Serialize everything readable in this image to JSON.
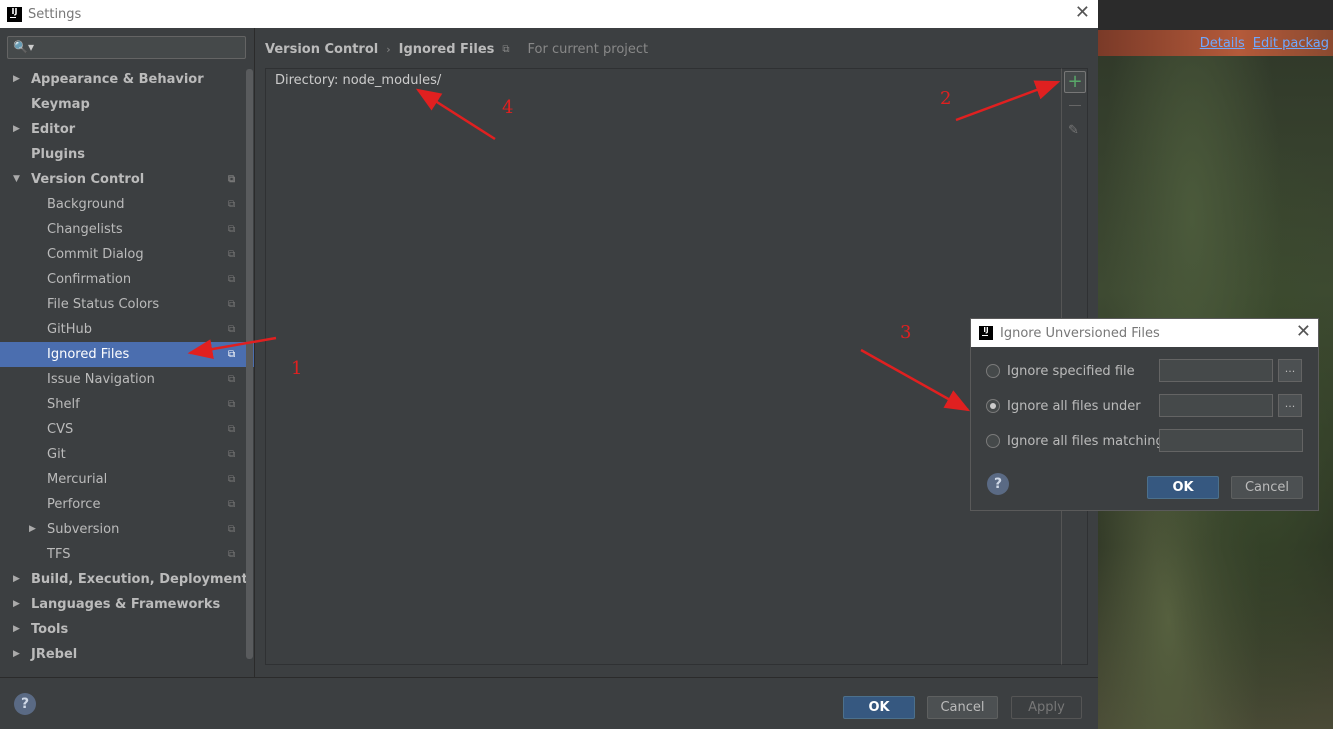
{
  "window": {
    "title": "Settings"
  },
  "background": {
    "links": [
      "Details",
      "Edit packag"
    ]
  },
  "search": {
    "placeholder": "",
    "icon": "search-icon"
  },
  "sidebar": {
    "items": [
      {
        "label": "Appearance & Behavior",
        "level": 0,
        "bold": true,
        "arrow": "collapsed",
        "copy": false
      },
      {
        "label": "Keymap",
        "level": 0,
        "bold": true,
        "arrow": "none",
        "copy": false
      },
      {
        "label": "Editor",
        "level": 0,
        "bold": true,
        "arrow": "collapsed",
        "copy": false
      },
      {
        "label": "Plugins",
        "level": 0,
        "bold": true,
        "arrow": "none",
        "copy": false
      },
      {
        "label": "Version Control",
        "level": 0,
        "bold": true,
        "arrow": "expanded",
        "copy": true
      },
      {
        "label": "Background",
        "level": 1,
        "bold": false,
        "arrow": "none",
        "copy": true
      },
      {
        "label": "Changelists",
        "level": 1,
        "bold": false,
        "arrow": "none",
        "copy": true
      },
      {
        "label": "Commit Dialog",
        "level": 1,
        "bold": false,
        "arrow": "none",
        "copy": true
      },
      {
        "label": "Confirmation",
        "level": 1,
        "bold": false,
        "arrow": "none",
        "copy": true
      },
      {
        "label": "File Status Colors",
        "level": 1,
        "bold": false,
        "arrow": "none",
        "copy": true
      },
      {
        "label": "GitHub",
        "level": 1,
        "bold": false,
        "arrow": "none",
        "copy": true
      },
      {
        "label": "Ignored Files",
        "level": 1,
        "bold": false,
        "arrow": "none",
        "copy": true,
        "selected": true
      },
      {
        "label": "Issue Navigation",
        "level": 1,
        "bold": false,
        "arrow": "none",
        "copy": true
      },
      {
        "label": "Shelf",
        "level": 1,
        "bold": false,
        "arrow": "none",
        "copy": true
      },
      {
        "label": "CVS",
        "level": 1,
        "bold": false,
        "arrow": "none",
        "copy": true
      },
      {
        "label": "Git",
        "level": 1,
        "bold": false,
        "arrow": "none",
        "copy": true
      },
      {
        "label": "Mercurial",
        "level": 1,
        "bold": false,
        "arrow": "none",
        "copy": true
      },
      {
        "label": "Perforce",
        "level": 1,
        "bold": false,
        "arrow": "none",
        "copy": true
      },
      {
        "label": "Subversion",
        "level": 1,
        "bold": false,
        "arrow": "collapsed",
        "copy": true
      },
      {
        "label": "TFS",
        "level": 1,
        "bold": false,
        "arrow": "none",
        "copy": true
      },
      {
        "label": "Build, Execution, Deployment",
        "level": 0,
        "bold": true,
        "arrow": "collapsed",
        "copy": false
      },
      {
        "label": "Languages & Frameworks",
        "level": 0,
        "bold": true,
        "arrow": "collapsed",
        "copy": false
      },
      {
        "label": "Tools",
        "level": 0,
        "bold": true,
        "arrow": "collapsed",
        "copy": false
      },
      {
        "label": "JRebel",
        "level": 0,
        "bold": true,
        "arrow": "collapsed",
        "copy": false
      }
    ]
  },
  "breadcrumb": {
    "parent": "Version Control",
    "separator": "›",
    "current": "Ignored Files",
    "scope": "For current project"
  },
  "ignored_list": {
    "entries": [
      "Directory: node_modules/"
    ]
  },
  "toolbar": {
    "add": "+",
    "remove": "−",
    "edit": "✎"
  },
  "footer": {
    "ok": "OK",
    "cancel": "Cancel",
    "apply": "Apply",
    "help": "?"
  },
  "dialog": {
    "title": "Ignore Unversioned Files",
    "options": [
      {
        "label": "Ignore specified file",
        "checked": false,
        "browse": true
      },
      {
        "label": "Ignore all files under",
        "checked": true,
        "browse": true
      },
      {
        "label": "Ignore all files matching",
        "checked": false,
        "browse": false
      }
    ],
    "browse_label": "...",
    "ok": "OK",
    "cancel": "Cancel",
    "help": "?"
  },
  "annotations": [
    "1",
    "2",
    "3",
    "4"
  ],
  "colors": {
    "selection": "#4b6eaf",
    "accent_add": "#59a869",
    "annotation": "#e02020",
    "primary_button": "#365880"
  }
}
